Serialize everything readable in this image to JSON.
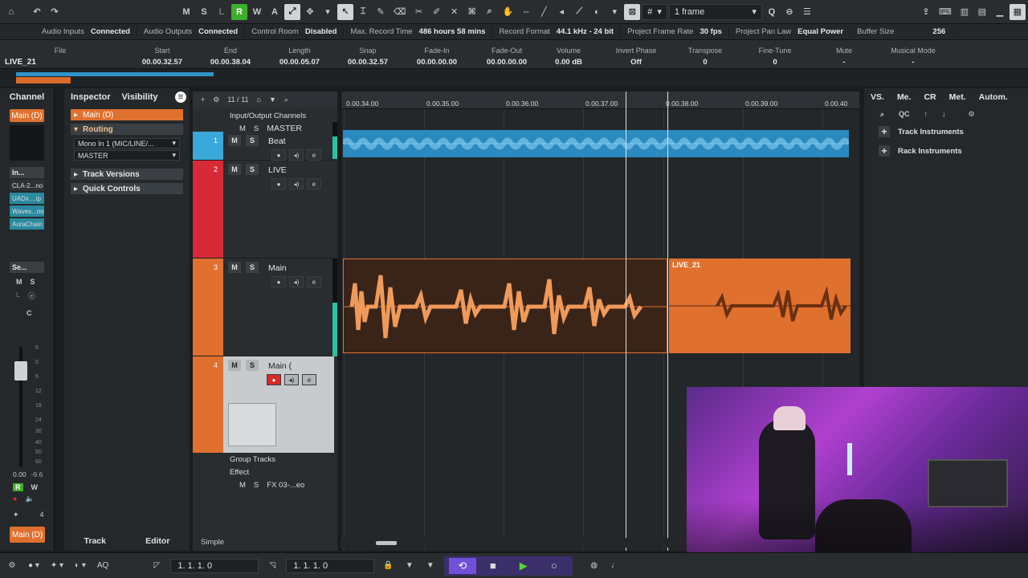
{
  "toolbar": {
    "mode_buttons": [
      "M",
      "S",
      "L",
      "R",
      "W",
      "A"
    ],
    "quantize_value": "1 frame"
  },
  "status_bar": [
    {
      "label": "Audio Inputs",
      "value": "Connected"
    },
    {
      "label": "Audio Outputs",
      "value": "Connected"
    },
    {
      "label": "Control Room",
      "value": "Disabled"
    },
    {
      "label": "Max. Record Time",
      "value": "486 hours 58 mins"
    },
    {
      "label": "Record Format",
      "value": "44.1 kHz - 24 bit"
    },
    {
      "label": "Project Frame Rate",
      "value": "30 fps"
    },
    {
      "label": "Project Pan Law",
      "value": "Equal Power"
    },
    {
      "label": "Buffer Size",
      "value": "256"
    }
  ],
  "info_line": {
    "event_name": "LIVE_21",
    "file_label": "File",
    "fields": [
      {
        "label": "Start",
        "value": "00.00.32.57"
      },
      {
        "label": "End",
        "value": "00.00.38.04"
      },
      {
        "label": "Length",
        "value": "00.00.05.07"
      },
      {
        "label": "Snap",
        "value": "00.00.32.57"
      },
      {
        "label": "Fade-In",
        "value": "00.00.00.00"
      },
      {
        "label": "Fade-Out",
        "value": "00.00.00.00"
      },
      {
        "label": "Volume",
        "value": "0.00   dB"
      },
      {
        "label": "Invert Phase",
        "value": "Off"
      },
      {
        "label": "Transpose",
        "value": "0"
      },
      {
        "label": "Fine-Tune",
        "value": "0"
      },
      {
        "label": "Mute",
        "value": "-"
      },
      {
        "label": "Musical Mode",
        "value": "-"
      }
    ]
  },
  "channel": {
    "title": "Channel",
    "main_label": "Main (D)",
    "inserts_label": "In...",
    "plugins": [
      "CLA-2...no",
      "UADx ...ip",
      "Waves...no",
      "AuraChain"
    ],
    "sends_label": "Se...",
    "scale": [
      "6",
      "0",
      "6",
      "12",
      "18",
      "24",
      "30",
      "40",
      "50",
      "60"
    ],
    "volume_value": "0.00",
    "peak_value": "-9.6",
    "channel_number": "4",
    "bottom_label": "Main (D)",
    "pan_label": "C"
  },
  "inspector": {
    "tabs": [
      "Inspector",
      "Visibility"
    ],
    "track_name": "Main (D)",
    "routing_label": "Routing",
    "input_value": "Mono In 1 (MIC/LINE/...",
    "output_value": "MASTER",
    "track_versions_label": "Track Versions",
    "quick_controls_label": "Quick Controls",
    "bottom_tabs": [
      "Track",
      "Editor"
    ]
  },
  "tracklist": {
    "counter": "11 / 11",
    "io_folder": "Input/Output Channels",
    "master": "MASTER",
    "tracks": [
      {
        "num": "1",
        "name": "Beat",
        "color": "#3aa8d8"
      },
      {
        "num": "2",
        "name": "LIVE",
        "color": "#d82a36"
      },
      {
        "num": "3",
        "name": "Main",
        "color": "#e0702e"
      },
      {
        "num": "4",
        "name": "Main (",
        "color": "#e0702e"
      }
    ],
    "group_folder": "Group Tracks",
    "effect_folder": "Effect",
    "fx_track": "FX 03-...eo",
    "mode_label": "Simple"
  },
  "ruler": {
    "ticks": [
      "0.00.34.00",
      "0.00.35.00",
      "0.00.36.00",
      "0.00.37.00",
      "0.00.38.00",
      "0.00.39.00",
      "0.00.40"
    ]
  },
  "events": {
    "live_label": "LIVE_21"
  },
  "right_panel": {
    "tabs": [
      "VS.",
      "Me.",
      "CR",
      "Met.",
      "Autom."
    ],
    "qc_label": "QC",
    "items": [
      "Track Instruments",
      "Rack Instruments"
    ]
  },
  "bottom_bar": {
    "left_pos": "1. 1. 1.    0",
    "right_pos": "1. 1. 1.    0",
    "aq_label": "AQ"
  },
  "colors": {
    "accent_orange": "#e0702e",
    "accent_blue": "#3aa8d8",
    "record_red": "#d82a2a",
    "cycle_purple": "#7050d8"
  }
}
